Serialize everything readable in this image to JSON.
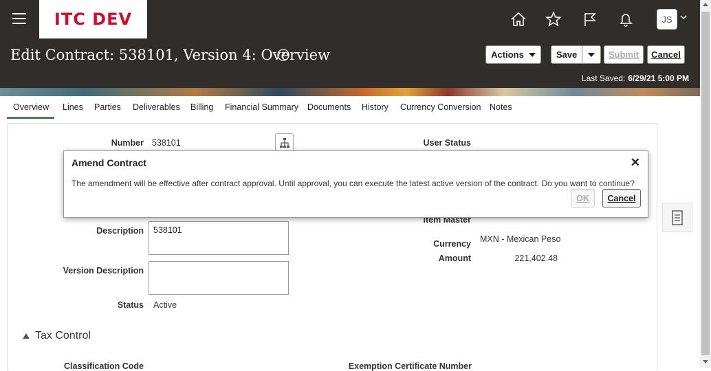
{
  "header": {
    "logo": "ITC DEV",
    "user_initials": "JS",
    "page_title": "Edit Contract: 538101, Version 4: Overview",
    "actions_label": "Actions",
    "save_label": "Save",
    "submit_label": "Submit",
    "cancel_label": "Cancel",
    "last_saved_label": "Last Saved:",
    "last_saved_value": "6/29/21 5:00 PM",
    "icons": [
      "home-icon",
      "favorites-star-icon",
      "flag-icon",
      "notifications-bell-icon"
    ]
  },
  "tabs": [
    "Overview",
    "Lines",
    "Parties",
    "Deliverables",
    "Billing",
    "Financial Summary",
    "Documents",
    "History",
    "Currency Conversion",
    "Notes"
  ],
  "form": {
    "number_label": "Number",
    "number_value": "538101",
    "user_status_label": "User Status",
    "item_master_label": "Item Master",
    "description_label": "Description",
    "description_value": "538101",
    "version_description_label": "Version Description",
    "version_description_value": "",
    "status_label": "Status",
    "status_value": "Active",
    "currency_label": "Currency",
    "currency_value": "MXN - Mexican Peso",
    "amount_label": "Amount",
    "amount_value": "221,402.48"
  },
  "tax_section": {
    "title": "Tax Control",
    "classification_code_label": "Classification Code",
    "exemption_certificate_label": "Exemption Certificate Number"
  },
  "dialog": {
    "title": "Amend Contract",
    "message": "The amendment will be effective after contract approval. Until approval, you can execute the latest active version of the contract. Do you want to continue?",
    "ok_label": "OK",
    "cancel_label": "Cancel"
  },
  "colors": {
    "header_bg": "#312d2a",
    "logo_red": "#c8102e",
    "active_tab_underline": "#4f7a5f"
  }
}
